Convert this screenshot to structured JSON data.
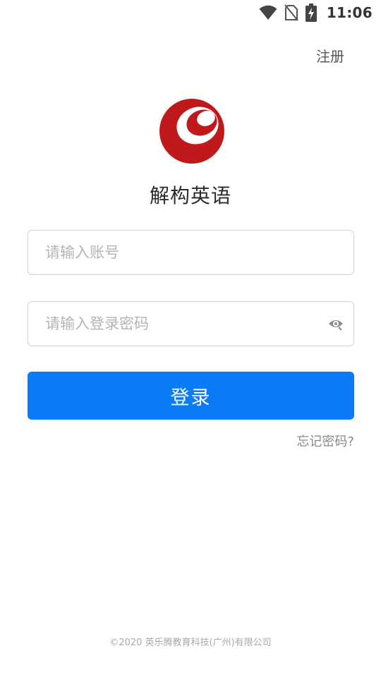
{
  "status_bar": {
    "time": "11:06",
    "icons": [
      "wifi-icon",
      "no-sim-icon",
      "battery-charging-icon"
    ]
  },
  "header": {
    "register_label": "注册"
  },
  "brand": {
    "app_name": "解构英语",
    "logo_color": "#c0191b"
  },
  "form": {
    "account_placeholder": "请输入账号",
    "account_value": "",
    "password_placeholder": "请输入登录密码",
    "password_value": "",
    "login_label": "登录",
    "forgot_password_label": "忘记密码?"
  },
  "footer": {
    "copyright": "©2020 英乐腾教育科技(广州)有限公司"
  },
  "colors": {
    "primary": "#0a7cf8",
    "border": "#d2d2d2",
    "placeholder": "#b4b4b4"
  }
}
